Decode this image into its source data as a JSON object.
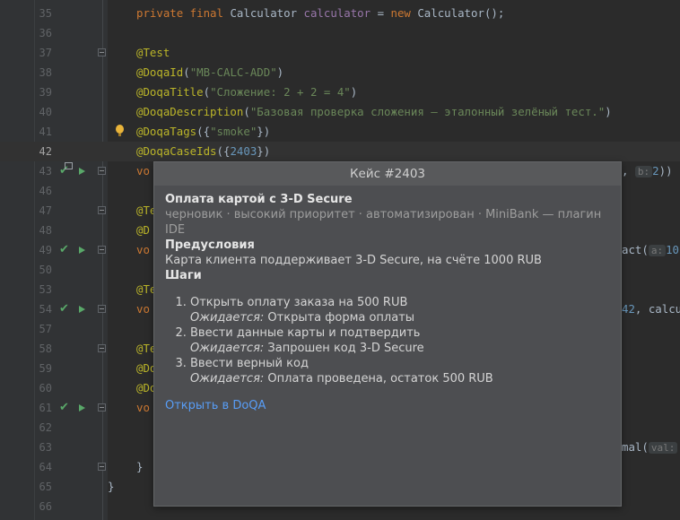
{
  "lines": [
    {
      "no": "35",
      "code": [
        [
          "kw",
          "private final "
        ],
        [
          "",
          "Calculator "
        ],
        [
          "fld",
          "calculator"
        ],
        [
          "",
          " = "
        ],
        [
          "kw",
          "new "
        ],
        [
          "",
          "Calculator();"
        ]
      ]
    },
    {
      "no": "36",
      "code": []
    },
    {
      "no": "37",
      "code": [
        [
          "an",
          "@Test"
        ]
      ]
    },
    {
      "no": "38",
      "code": [
        [
          "an",
          "@DoqaId"
        ],
        [
          "",
          "("
        ],
        [
          "st",
          "\"MB-CALC-ADD\""
        ],
        [
          "",
          ")"
        ]
      ]
    },
    {
      "no": "39",
      "code": [
        [
          "an",
          "@DoqaTitle"
        ],
        [
          "",
          "("
        ],
        [
          "st",
          "\"Сложение: 2 + 2 = 4\""
        ],
        [
          "",
          ")"
        ]
      ]
    },
    {
      "no": "40",
      "code": [
        [
          "an",
          "@DoqaDescription"
        ],
        [
          "",
          "("
        ],
        [
          "st",
          "\"Базовая проверка сложения — эталонный зелёный тест.\""
        ],
        [
          "",
          ")"
        ]
      ]
    },
    {
      "no": "41",
      "code": [
        [
          "an",
          "@DoqaTags"
        ],
        [
          "",
          "({"
        ],
        [
          "st",
          "\"smoke\""
        ],
        [
          "",
          "})"
        ]
      ]
    },
    {
      "no": "42",
      "code": [
        [
          "an",
          "@DoqaCaseIds"
        ],
        [
          "",
          "({"
        ],
        [
          "nm",
          "2403"
        ],
        [
          "",
          "})"
        ]
      ]
    },
    {
      "no": "43",
      "code": [
        [
          "kw",
          "vo"
        ]
      ]
    },
    {
      "no": "46",
      "code": []
    },
    {
      "no": "47",
      "code": [
        [
          "an",
          "@Te"
        ]
      ]
    },
    {
      "no": "48",
      "code": [
        [
          "an",
          "@D"
        ]
      ]
    },
    {
      "no": "49",
      "code": [
        [
          "kw",
          "vo"
        ]
      ]
    },
    {
      "no": "50",
      "code": []
    },
    {
      "no": "53",
      "code": [
        [
          "an",
          "@Te"
        ]
      ]
    },
    {
      "no": "54",
      "code": [
        [
          "kw",
          "vo"
        ]
      ]
    },
    {
      "no": "57",
      "code": []
    },
    {
      "no": "58",
      "code": [
        [
          "an",
          "@Te"
        ]
      ]
    },
    {
      "no": "59",
      "code": [
        [
          "an",
          "@Do"
        ]
      ]
    },
    {
      "no": "60",
      "code": [
        [
          "an",
          "@Do"
        ]
      ]
    },
    {
      "no": "61",
      "code": [
        [
          "kw",
          "vo"
        ]
      ]
    },
    {
      "no": "62",
      "code": []
    },
    {
      "no": "63",
      "code": []
    },
    {
      "no": "64",
      "code": [
        [
          "",
          "}"
        ]
      ]
    },
    {
      "no": "65",
      "code": [
        [
          "",
          "}"
        ]
      ]
    },
    {
      "no": "66",
      "code": []
    }
  ],
  "right_fragments": {
    "l43_prefix": ", ",
    "l43_hint": "b:",
    "l43_num": "2",
    "l43_suffix": "))",
    "l49_text": "act(",
    "l49_hint": "a:",
    "l49_num": "10",
    "l54_num": "42",
    "l54_text": ", calcu",
    "l63_text": "mal(",
    "l63_hint": "val:"
  },
  "popup": {
    "header": "Кейс #2403",
    "title": "Оплата картой с 3-D Secure",
    "meta": "черновик · высокий приоритет · автоматизирован · MiniBank — плагин IDE",
    "preconditions_label": "Предусловия",
    "preconditions": "Карта клиента поддерживает 3-D Secure, на счёте 1000 RUB",
    "steps_label": "Шаги",
    "expected_label": "Ожидается:",
    "steps": [
      {
        "action": "Открыть оплату заказа на 500 RUB",
        "expected": "Открыта форма оплаты"
      },
      {
        "action": "Ввести данные карты и подтвердить",
        "expected": "Запрошен код 3-D Secure"
      },
      {
        "action": "Ввести верный код",
        "expected": "Оплата проведена, остаток 500 RUB"
      }
    ],
    "link": "Открыть в DoQA"
  },
  "icons": {
    "check": "check-icon",
    "run": "run-icon",
    "fold": "fold-icon",
    "bulb": "intention-bulb-icon"
  }
}
